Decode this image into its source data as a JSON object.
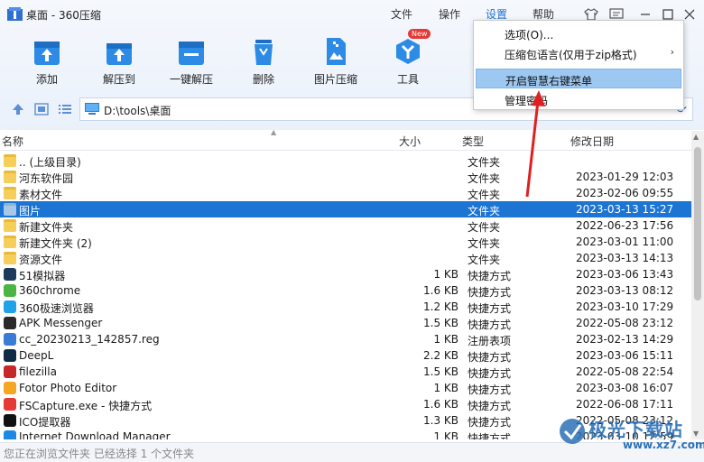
{
  "window": {
    "title": "桌面 - 360压缩",
    "menu": [
      "文件",
      "操作",
      "设置",
      "帮助"
    ]
  },
  "toolbar": [
    {
      "label": "添加",
      "icon": "add-box-icon"
    },
    {
      "label": "解压到",
      "icon": "extract-to-icon"
    },
    {
      "label": "一键解压",
      "icon": "one-click-extract-icon"
    },
    {
      "label": "删除",
      "icon": "trash-icon"
    },
    {
      "label": "图片压缩",
      "icon": "image-compress-icon"
    },
    {
      "label": "工具",
      "icon": "tools-icon",
      "badge": "New"
    }
  ],
  "path": {
    "value": "D:\\tools\\桌面"
  },
  "columns": {
    "name": "名称",
    "size": "大小",
    "type": "类型",
    "date": "修改日期"
  },
  "files": [
    {
      "name": ".. (上级目录)",
      "size": "",
      "type": "文件夹",
      "date": "",
      "icon": "folder-icon"
    },
    {
      "name": "河东软件园",
      "size": "",
      "type": "文件夹",
      "date": "2023-01-29 12:03",
      "icon": "folder-icon"
    },
    {
      "name": "素材文件",
      "size": "",
      "type": "文件夹",
      "date": "2023-02-06 09:55",
      "icon": "folder-icon"
    },
    {
      "name": "图片",
      "size": "",
      "type": "文件夹",
      "date": "2023-03-13 15:27",
      "icon": "folder-icon",
      "selected": true
    },
    {
      "name": "新建文件夹",
      "size": "",
      "type": "文件夹",
      "date": "2022-06-23 17:56",
      "icon": "folder-icon"
    },
    {
      "name": "新建文件夹 (2)",
      "size": "",
      "type": "文件夹",
      "date": "2023-03-01 11:00",
      "icon": "folder-icon"
    },
    {
      "name": "资源文件",
      "size": "",
      "type": "文件夹",
      "date": "2023-03-13 14:13",
      "icon": "folder-icon"
    },
    {
      "name": "51模拟器",
      "size": "1 KB",
      "type": "快捷方式",
      "date": "2023-03-06 13:43",
      "icon": "emulator-icon"
    },
    {
      "name": "360chrome",
      "size": "1.6 KB",
      "type": "快捷方式",
      "date": "2023-03-13 08:12",
      "icon": "chrome-icon"
    },
    {
      "name": "360极速浏览器",
      "size": "1.2 KB",
      "type": "快捷方式",
      "date": "2023-03-10 17:29",
      "icon": "browser-icon"
    },
    {
      "name": "APK Messenger",
      "size": "1.5 KB",
      "type": "快捷方式",
      "date": "2022-05-08 23:12",
      "icon": "apk-icon"
    },
    {
      "name": "cc_20230213_142857.reg",
      "size": "1 KB",
      "type": "注册表项",
      "date": "2023-02-13 14:29",
      "icon": "registry-file-icon"
    },
    {
      "name": "DeepL",
      "size": "2.2 KB",
      "type": "快捷方式",
      "date": "2023-03-06 15:11",
      "icon": "deepl-icon"
    },
    {
      "name": "filezilla",
      "size": "1.5 KB",
      "type": "快捷方式",
      "date": "2022-05-08 22:54",
      "icon": "filezilla-icon"
    },
    {
      "name": "Fotor Photo Editor",
      "size": "1 KB",
      "type": "快捷方式",
      "date": "2023-03-08 16:07",
      "icon": "fotor-icon"
    },
    {
      "name": "FSCapture.exe - 快捷方式",
      "size": "1.6 KB",
      "type": "快捷方式",
      "date": "2022-06-08 17:11",
      "icon": "fscapture-icon"
    },
    {
      "name": "ICO提取器",
      "size": "1.3 KB",
      "type": "快捷方式",
      "date": "2022-05-08 23:12",
      "icon": "ico-extractor-icon"
    },
    {
      "name": "Internet Download Manager",
      "size": "1 KB",
      "type": "快捷方式",
      "date": "2023-03-10 12:59",
      "icon": "idm-icon"
    }
  ],
  "status": "您正在浏览文件夹 已经选择 1 个文件夹",
  "dropdown": {
    "items": [
      {
        "label": "选项(O)...",
        "submenu": false
      },
      {
        "label": "压缩包语言(仅用于zip格式)",
        "submenu": true
      },
      {
        "label": "开启智慧右键菜单",
        "submenu": false,
        "highlighted": true
      },
      {
        "label": "管理密码",
        "submenu": false
      }
    ]
  },
  "watermark": {
    "text": "极光下载站",
    "url": "www.xz7.com"
  },
  "colors": {
    "selection": "#1c74d3",
    "accent": "#1f6fd0",
    "menu_highlight": "#9dc8f2",
    "arrow": "#e02020"
  }
}
